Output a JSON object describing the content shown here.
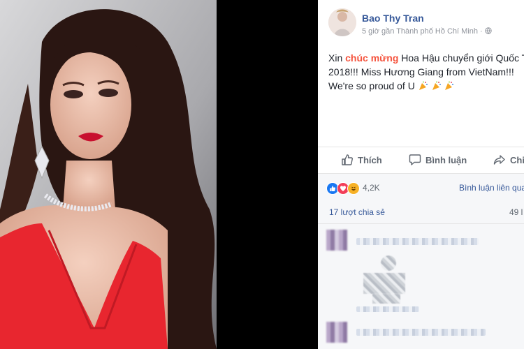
{
  "post": {
    "author": "Bao Thy Tran",
    "meta": "5 giờ gần Thành phố Hồ Chí Minh · ",
    "text": {
      "prefix": "Xin ",
      "highlight": "chúc mừng",
      "line1_rest": " Hoa Hậu chuyển giới Quốc T",
      "line2": "2018!!! Miss Hương Giang from VietNam!!!",
      "line3": "We're so proud of U"
    }
  },
  "actions": {
    "like": "Thích",
    "comment": "Bình luận",
    "share": "Chi"
  },
  "stats": {
    "reactions_count": "4,2K",
    "comments_link": "Bình luận liên quan",
    "shares": "17 lượt chia sẻ",
    "views": "49 l"
  },
  "colors": {
    "brand_blue": "#365899",
    "highlight_red": "#f5533d",
    "like_blue": "#1877f2",
    "love_red": "#f33e58",
    "haha_yellow": "#f7b125"
  },
  "icons": {
    "party": "party-popper-icon",
    "globe": "globe-icon",
    "like": "thumbs-up-icon",
    "comment": "speech-bubble-icon",
    "share": "share-arrow-icon"
  }
}
